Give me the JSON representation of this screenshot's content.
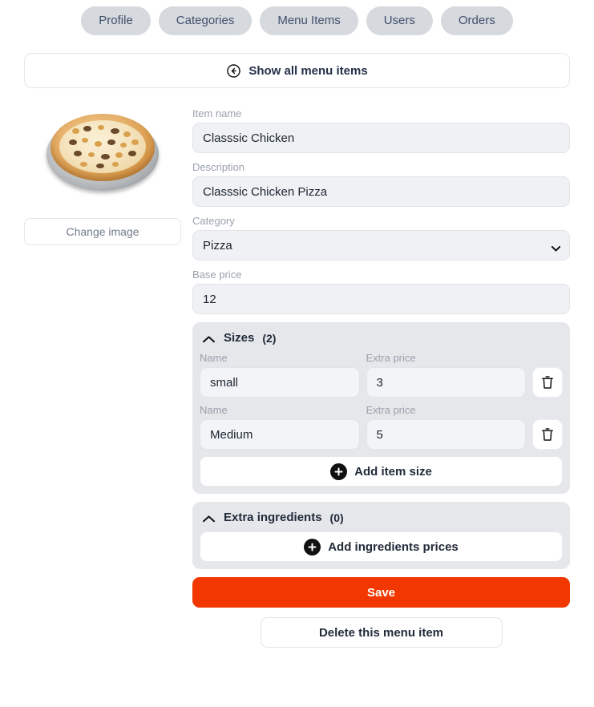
{
  "nav": {
    "tabs": [
      {
        "label": "Profile",
        "name": "tab-profile"
      },
      {
        "label": "Categories",
        "name": "tab-categories"
      },
      {
        "label": "Menu Items",
        "name": "tab-menu-items"
      },
      {
        "label": "Users",
        "name": "tab-users"
      },
      {
        "label": "Orders",
        "name": "tab-orders"
      }
    ]
  },
  "backbar": {
    "label": "Show all menu items",
    "icon": "circle-arrow-left-icon"
  },
  "image_panel": {
    "change_image_label": "Change image",
    "image_alt": "chicken pizza on silver pan"
  },
  "form": {
    "item_name": {
      "label": "Item name",
      "value": "Classsic Chicken"
    },
    "description": {
      "label": "Description",
      "value": "Classsic Chicken Pizza"
    },
    "category": {
      "label": "Category",
      "value": "Pizza",
      "options": [
        "Pizza"
      ],
      "icon": "chevron-down-icon"
    },
    "base_price": {
      "label": "Base price",
      "value": "12"
    }
  },
  "sizes_panel": {
    "title": "Sizes",
    "count": "(2)",
    "collapse_icon": "chevron-up-icon",
    "name_label": "Name",
    "price_label": "Extra price",
    "delete_icon": "trash-icon",
    "rows": [
      {
        "name": "small",
        "extra_price": "3"
      },
      {
        "name": "Medium",
        "extra_price": "5"
      }
    ],
    "add_label": "Add item size",
    "add_icon": "plus-circle-icon"
  },
  "ingredients_panel": {
    "title": "Extra ingredients",
    "count": "(0)",
    "collapse_icon": "chevron-up-icon",
    "rows": [],
    "add_label": "Add ingredients prices",
    "add_icon": "plus-circle-icon"
  },
  "actions": {
    "save_label": "Save",
    "delete_label": "Delete this menu item"
  },
  "colors": {
    "accent": "#f23800",
    "panel_bg": "#e5e7eb",
    "pill_bg": "#d6d9de",
    "input_bg": "#eff1f4"
  }
}
